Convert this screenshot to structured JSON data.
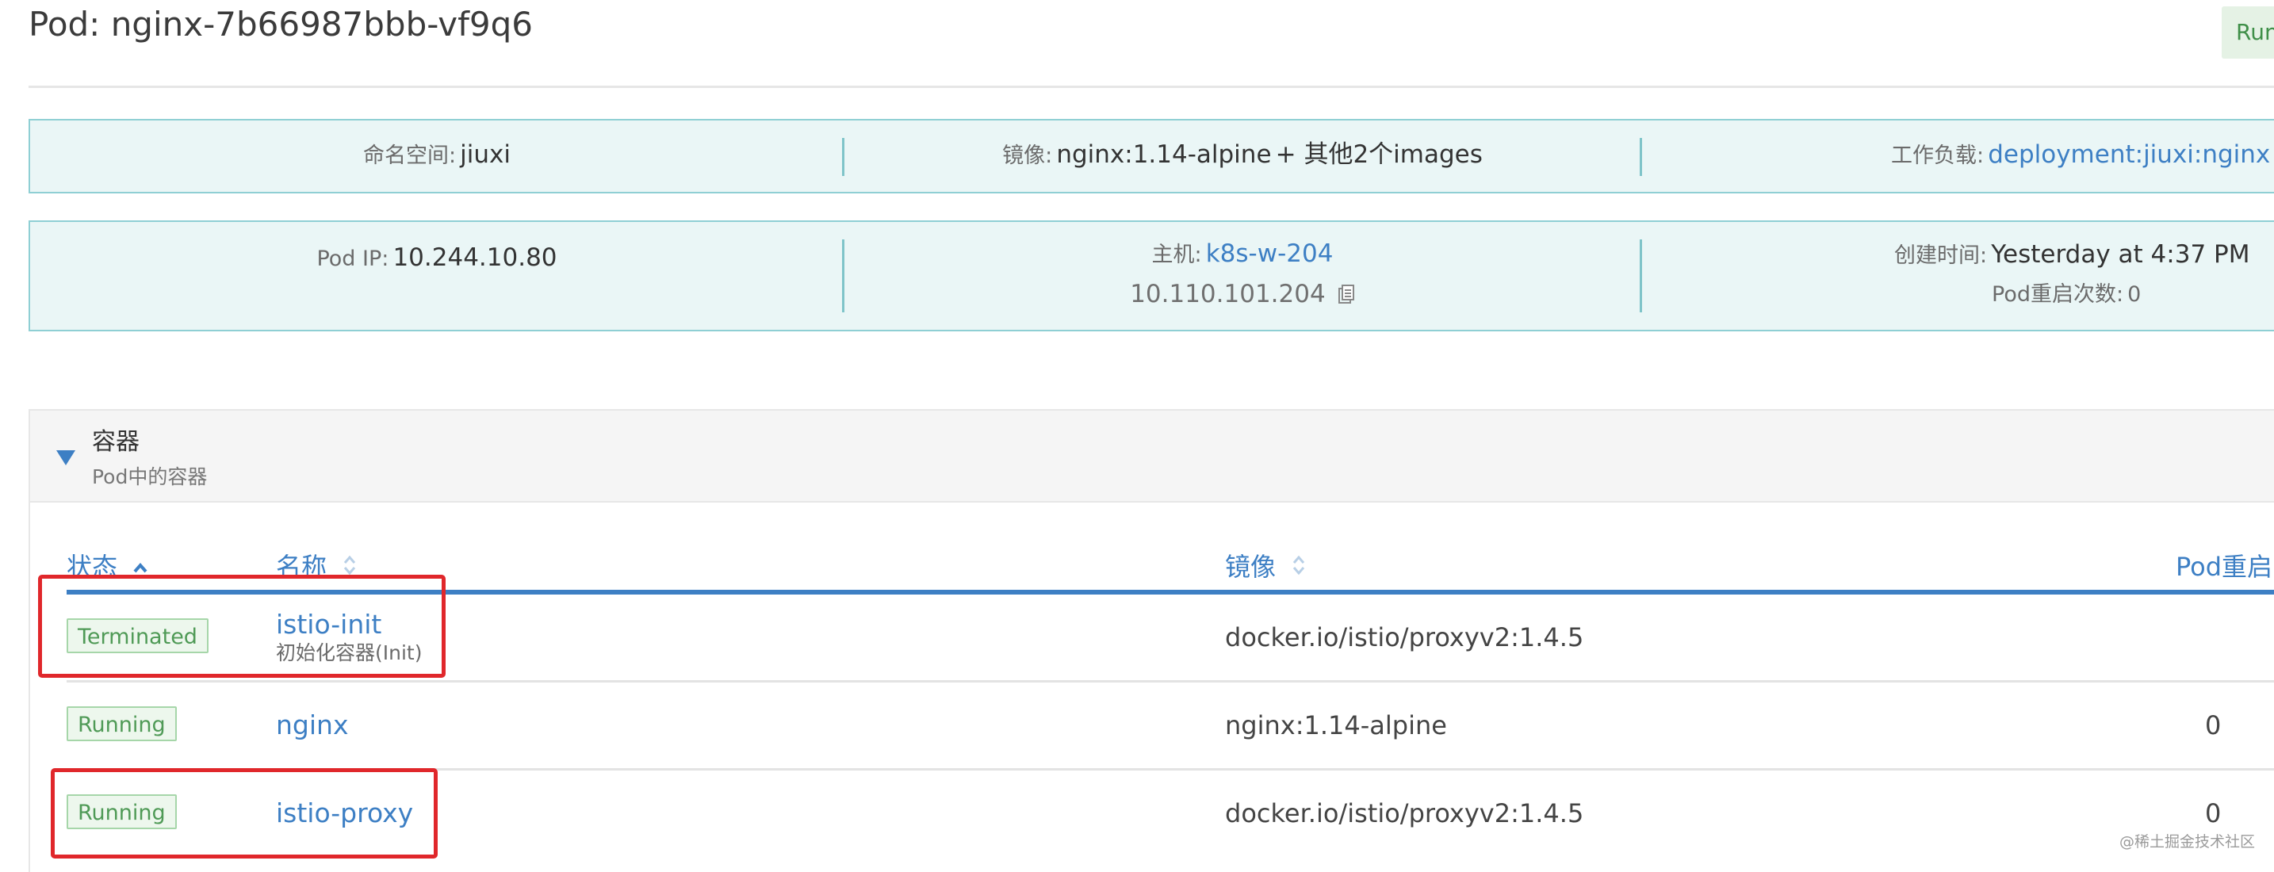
{
  "header": {
    "title": "Pod: nginx-7b66987bbb-vf9q6",
    "status_label": "Running"
  },
  "info_row1": {
    "namespace_label": "命名空间:",
    "namespace_value": "jiuxi",
    "image_label": "镜像:",
    "image_value": "nginx:1.14-alpine",
    "image_more": "+ 其他2个images",
    "workload_label": "工作负载:",
    "workload_value": "deployment:jiuxi:nginx"
  },
  "info_row2": {
    "pod_ip_label": "Pod IP:",
    "pod_ip_value": "10.244.10.80",
    "host_label": "主机:",
    "host_value": "k8s-w-204",
    "host_ip": "10.110.101.204",
    "created_label": "创建时间:",
    "created_value": "Yesterday at 4:37 PM",
    "restarts_label": "Pod重启次数:",
    "restarts_value": "0"
  },
  "containers_section": {
    "title": "容器",
    "subtitle": "Pod中的容器",
    "columns": {
      "state": "状态",
      "name": "名称",
      "image": "镜像",
      "restarts": "Pod重启"
    },
    "rows": [
      {
        "state": "Terminated",
        "name": "istio-init",
        "subtitle": "初始化容器(Init)",
        "image": "docker.io/istio/proxyv2:1.4.5",
        "restarts": ""
      },
      {
        "state": "Running",
        "name": "nginx",
        "subtitle": "",
        "image": "nginx:1.14-alpine",
        "restarts": "0"
      },
      {
        "state": "Running",
        "name": "istio-proxy",
        "subtitle": "",
        "image": "docker.io/istio/proxyv2:1.4.5",
        "restarts": "0"
      }
    ]
  },
  "watermark": "@稀土掘金技术社区",
  "colors": {
    "link_blue": "#3d7fc4",
    "info_bg": "#eaf6f6",
    "info_border": "#8fcfd4",
    "running_green": "#4f9a56",
    "highlight_red": "#e0272b"
  },
  "icons": {
    "copy": "copy-icon",
    "caret": "caret-down-icon",
    "sort_active": "sort-asc-icon",
    "sort": "sort-icon"
  }
}
